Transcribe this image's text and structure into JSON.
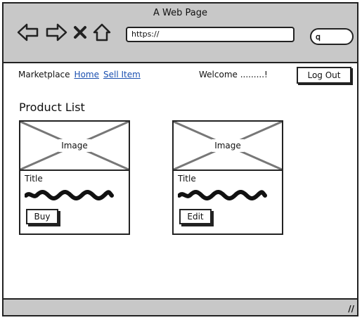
{
  "window": {
    "title": "A Web Page"
  },
  "browser": {
    "url": "https://",
    "icons": [
      "back-arrow-icon",
      "forward-arrow-icon",
      "close-icon",
      "home-icon",
      "search-icon"
    ]
  },
  "nav": {
    "brand": "Marketplace",
    "links": [
      "Home",
      "Sell Item"
    ],
    "welcome": "Welcome .........!",
    "logout": "Log Out"
  },
  "main": {
    "heading": "Product List",
    "products": [
      {
        "image_label": "Image",
        "title": "Title",
        "button": "Buy"
      },
      {
        "image_label": "Image",
        "title": "Title",
        "button": "Edit"
      }
    ]
  },
  "colors": {
    "chrome": "#c8c8c8",
    "link": "#1a4fb0",
    "stroke": "#222222"
  }
}
